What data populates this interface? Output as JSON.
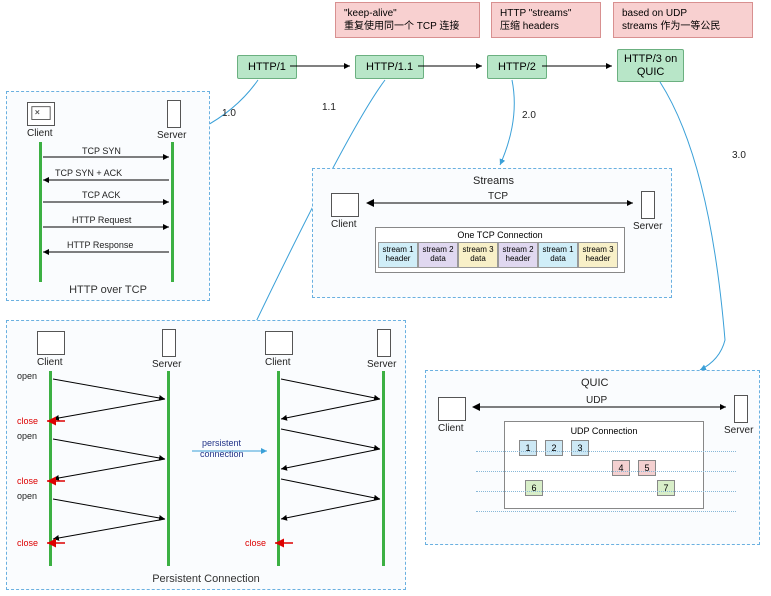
{
  "callouts": {
    "c1": {
      "line1": "\"keep-alive\"",
      "line2": "重复使用同一个 TCP 连接"
    },
    "c2": {
      "line1": "HTTP \"streams\"",
      "line2": "压缩 headers"
    },
    "c3": {
      "line1": "based on UDP",
      "line2": "streams 作为一等公民"
    }
  },
  "http": {
    "h1": "HTTP/1",
    "h11": "HTTP/1.1",
    "h2": "HTTP/2",
    "h3a": "HTTP/3 on",
    "h3b": "QUIC"
  },
  "flow": {
    "v10": "1.0",
    "v11": "1.1",
    "v20": "2.0",
    "v30": "3.0"
  },
  "roles": {
    "client": "Client",
    "server": "Server"
  },
  "tcp": {
    "title": "HTTP over TCP",
    "m1": "TCP SYN",
    "m2": "TCP SYN + ACK",
    "m3": "TCP ACK",
    "m4": "HTTP Request",
    "m5": "HTTP Response"
  },
  "persist": {
    "title": "Persistent Connection",
    "open": "open",
    "close": "close",
    "pc1": "persistent",
    "pc2": "connection"
  },
  "streams": {
    "title": "Streams",
    "one": "One TCP Connection",
    "tcp": "TCP",
    "cells": [
      {
        "l1": "stream 1",
        "l2": "header",
        "bg": "#d0eef8"
      },
      {
        "l1": "stream 2",
        "l2": "data",
        "bg": "#e0d8f0"
      },
      {
        "l1": "stream 3",
        "l2": "data",
        "bg": "#f8f0c8"
      },
      {
        "l1": "stream 2",
        "l2": "header",
        "bg": "#e0d8f0"
      },
      {
        "l1": "stream 1",
        "l2": "data",
        "bg": "#d0eef8"
      },
      {
        "l1": "stream 3",
        "l2": "header",
        "bg": "#f8f0c8"
      }
    ]
  },
  "quic": {
    "title": "QUIC",
    "udp": "UDP",
    "conn": "UDP Connection",
    "r1": [
      {
        "n": "1",
        "bg": "#cde8f4"
      },
      {
        "n": "2",
        "bg": "#cde8f4"
      },
      {
        "n": "3",
        "bg": "#cde8f4"
      }
    ],
    "r2": [
      {
        "n": "4",
        "bg": "#f4d0d0"
      },
      {
        "n": "5",
        "bg": "#f4d0d0"
      }
    ],
    "r3": [
      {
        "n": "6",
        "bg": "#d8eec8"
      },
      {
        "n": "7",
        "bg": "#d8eec8"
      }
    ]
  }
}
